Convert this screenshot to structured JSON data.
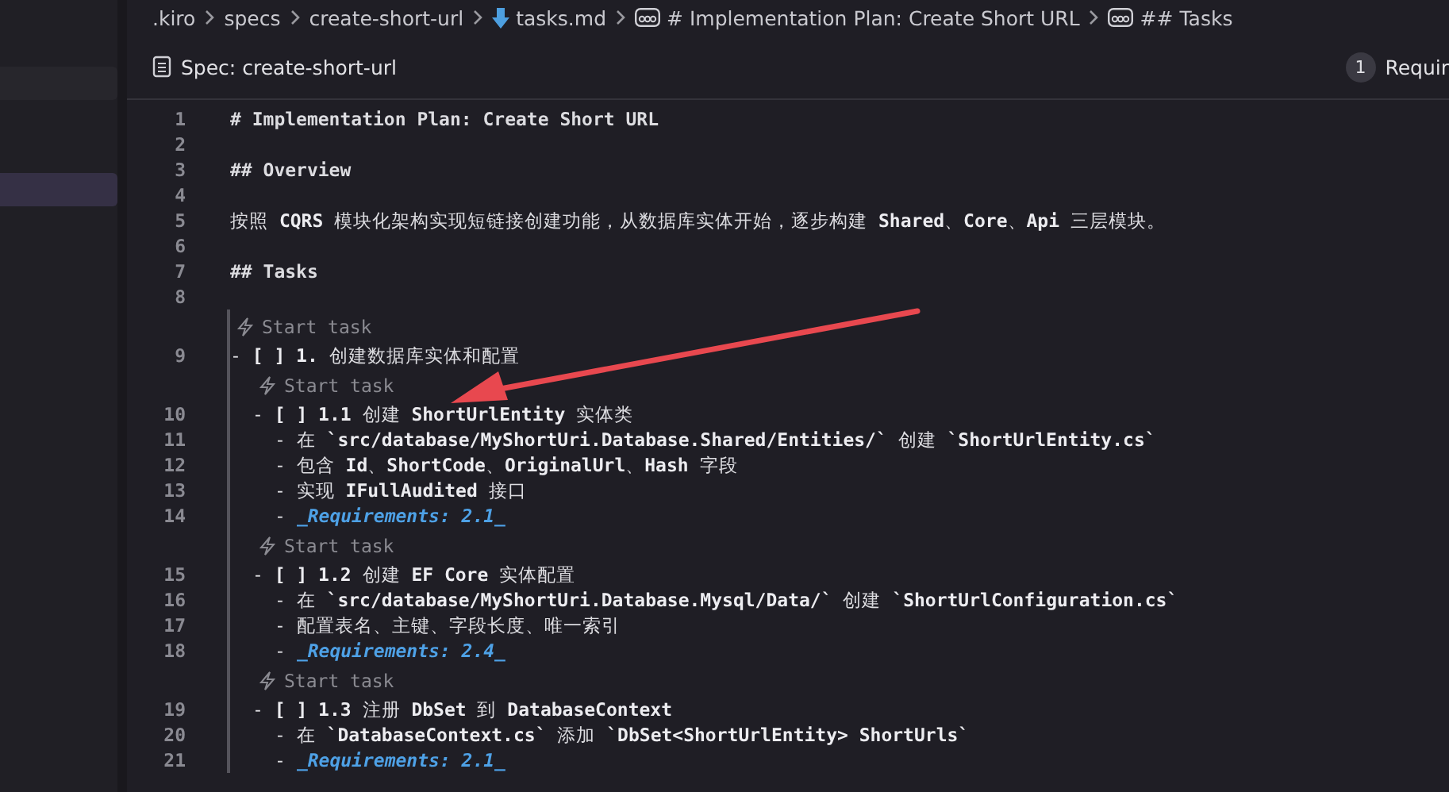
{
  "breadcrumbs": [
    {
      "label": ".kiro",
      "kind": "folder"
    },
    {
      "label": "specs",
      "kind": "folder"
    },
    {
      "label": "create-short-url",
      "kind": "folder"
    },
    {
      "label": "tasks.md",
      "kind": "file"
    },
    {
      "label": "# Implementation Plan: Create Short URL",
      "kind": "section"
    },
    {
      "label": "## Tasks",
      "kind": "section"
    }
  ],
  "spec_bar": {
    "title": "Spec: create-short-url",
    "step_number": "1",
    "step_label": "Requir"
  },
  "sidebar": {
    "items": [
      {
        "selected": false
      },
      {
        "selected": true
      }
    ]
  },
  "lines": [
    {
      "number": "1",
      "kind": "heading",
      "text": "# Implementation Plan: Create Short URL"
    },
    {
      "number": "2",
      "kind": "blank"
    },
    {
      "number": "3",
      "kind": "heading",
      "text": "## Overview"
    },
    {
      "number": "4",
      "kind": "blank"
    },
    {
      "number": "5",
      "kind": "text",
      "text": "按照 **CQRS** 模块化架构实现短链接创建功能，从数据库实体开始，逐步构建 **Shared**、**Core**、**Api** 三层模块。"
    },
    {
      "number": "6",
      "kind": "blank"
    },
    {
      "number": "7",
      "kind": "heading",
      "text": "## Tasks"
    },
    {
      "number": "8",
      "kind": "blank"
    }
  ],
  "tasks": [
    {
      "codelens": "Start task",
      "number": "9",
      "text": "- **[ ] 1.** 创建数据库实体和配置",
      "children": [
        {
          "codelens": "Start task",
          "number": "10",
          "text": "- **[ ] 1.1** 创建 **ShortUrlEntity** 实体类",
          "details": [
            {
              "number": "11",
              "kind": "text",
              "text": "- 在 **`src/database/MyShortUri.Database.Shared/Entities/`** 创建 **`ShortUrlEntity.cs`**"
            },
            {
              "number": "12",
              "kind": "text",
              "text": "- 包含 **Id**、**ShortCode**、**OriginalUrl**、**Hash** 字段"
            },
            {
              "number": "13",
              "kind": "text",
              "text": "- 实现 **IFullAudited** 接口"
            },
            {
              "number": "14",
              "kind": "requirement",
              "prefix": "-",
              "text": "_Requirements: 2.1_"
            }
          ]
        },
        {
          "codelens": "Start task",
          "number": "15",
          "text": "- **[ ] 1.2** 创建 **EF Core** 实体配置",
          "details": [
            {
              "number": "16",
              "kind": "text",
              "text": "- 在 **`src/database/MyShortUri.Database.Mysql/Data/`** 创建 **`ShortUrlConfiguration.cs`**"
            },
            {
              "number": "17",
              "kind": "text",
              "text": "- 配置表名、主键、字段长度、唯一索引"
            },
            {
              "number": "18",
              "kind": "requirement",
              "prefix": "-",
              "text": "_Requirements: 2.4_"
            }
          ]
        },
        {
          "codelens": "Start task",
          "number": "19",
          "text": "- **[ ] 1.3** 注册 **DbSet** 到 **DatabaseContext**",
          "details": [
            {
              "number": "20",
              "kind": "text",
              "text": "- 在 **`DatabaseContext.cs`** 添加 **`DbSet<ShortUrlEntity> ShortUrls`**"
            },
            {
              "number": "21",
              "kind": "requirement",
              "prefix": "-",
              "text": "_Requirements: 2.1_"
            }
          ]
        }
      ]
    }
  ]
}
